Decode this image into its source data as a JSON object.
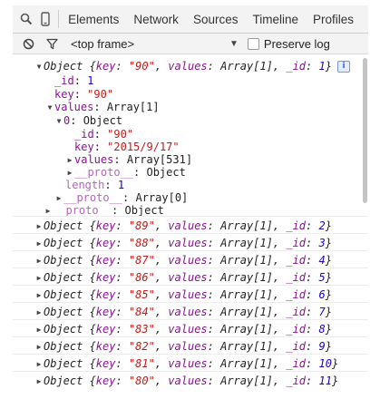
{
  "tabs": [
    {
      "label": "Elements"
    },
    {
      "label": "Network"
    },
    {
      "label": "Sources"
    },
    {
      "label": "Timeline"
    },
    {
      "label": "Profiles"
    }
  ],
  "icons": {
    "search": "search-icon",
    "device": "mobile-device-icon",
    "clear": "clear-console-icon",
    "filter": "filter-icon",
    "info": "info-icon"
  },
  "toolbar": {
    "frame": "<top frame>",
    "preserve_label": "Preserve log",
    "preserve_checked": false
  },
  "console": {
    "expanded": {
      "summary": {
        "prefix": "Object {",
        "key": "\"90\"",
        "values": "Array[1]",
        "id": "1"
      },
      "id_label": "_id",
      "id_value": "1",
      "key_label": "key",
      "key_value": "\"90\"",
      "values_label": "values",
      "values_type": "Array[1]",
      "item": {
        "index": "0",
        "type": "Object",
        "id_label": "_id",
        "id_value": "\"90\"",
        "key_label": "key",
        "key_value": "\"2015/9/17\"",
        "values_label": "values",
        "values_type": "Array[531]",
        "proto_label": "__proto__",
        "proto_type": "Object"
      },
      "length_label": "length",
      "length_value": "1",
      "array_proto_label": "__proto__",
      "array_proto_type": "Array[0]",
      "proto_label": "__proto__",
      "proto_type": "Object"
    },
    "collapsed": [
      {
        "key": "\"89\"",
        "values": "Array[1]",
        "id": "2"
      },
      {
        "key": "\"88\"",
        "values": "Array[1]",
        "id": "3"
      },
      {
        "key": "\"87\"",
        "values": "Array[1]",
        "id": "4"
      },
      {
        "key": "\"86\"",
        "values": "Array[1]",
        "id": "5"
      },
      {
        "key": "\"85\"",
        "values": "Array[1]",
        "id": "6"
      },
      {
        "key": "\"84\"",
        "values": "Array[1]",
        "id": "7"
      },
      {
        "key": "\"83\"",
        "values": "Array[1]",
        "id": "8"
      },
      {
        "key": "\"82\"",
        "values": "Array[1]",
        "id": "9"
      },
      {
        "key": "\"81\"",
        "values": "Array[1]",
        "id": "10"
      },
      {
        "key": "\"80\"",
        "values": "Array[1]",
        "id": "11"
      }
    ]
  },
  "colors": {
    "key": "#881391",
    "string": "#c41a16",
    "number": "#1c00cf"
  }
}
